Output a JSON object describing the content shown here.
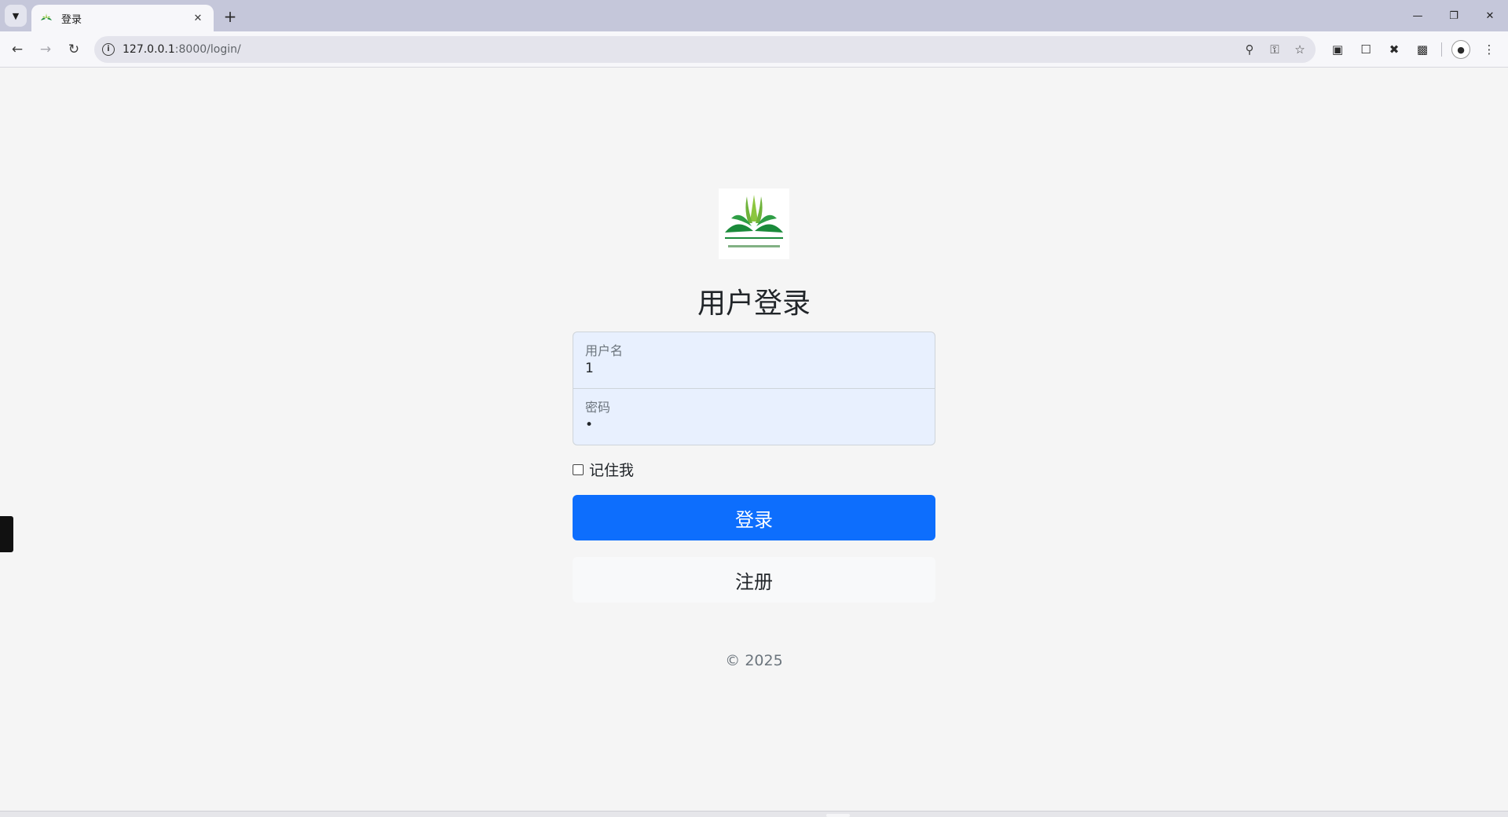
{
  "browser": {
    "tab_list_icon": "chevron-down-icon",
    "tab_title": "登录",
    "tab_close_icon": "close-icon",
    "new_tab_icon": "plus-icon",
    "window_controls": [
      "minimize-icon",
      "restore-icon",
      "close-icon"
    ],
    "url_host": "127.0.0.1",
    "url_path": ":8000/login/",
    "omnibox_icons": [
      "zoom-icon",
      "password-key-icon",
      "bookmark-star-icon"
    ],
    "extension_icons": [
      "extension-a-icon",
      "bookmarks-icon",
      "extension-x-icon",
      "puzzle-icon"
    ]
  },
  "page": {
    "title": "用户登录",
    "username": {
      "label": "用户名",
      "value": "1"
    },
    "password": {
      "label": "密码",
      "value": "•"
    },
    "remember_label": "记住我",
    "remember_checked": false,
    "login_button": "登录",
    "register_button": "注册",
    "copyright": "© 2025"
  },
  "colors": {
    "primary": "#0d6efd",
    "input_autofill_bg": "#e8f0fe",
    "page_bg": "#f5f5f5",
    "logo_green_dark": "#1a8a3a",
    "logo_green_light": "#8cc63f"
  }
}
